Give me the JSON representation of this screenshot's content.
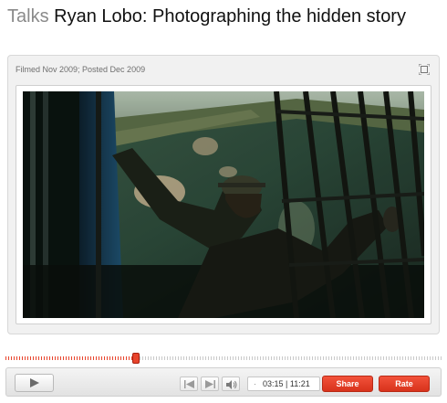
{
  "header": {
    "section": "Talks",
    "title": "Ryan Lobo: Photographing the hidden story"
  },
  "player": {
    "meta": "Filmed Nov 2009; Posted Dec 2009",
    "progress": 0.3,
    "time": {
      "current": "03:15",
      "separator": "|",
      "total": "11:21"
    },
    "share_label": "Share",
    "rate_label": "Rate",
    "accent_color": "#e8442c"
  },
  "icons": {
    "fullscreen": "fullscreen-icon",
    "play": "play-icon",
    "previous": "previous-icon",
    "next": "next-icon",
    "volume": "volume-icon"
  }
}
